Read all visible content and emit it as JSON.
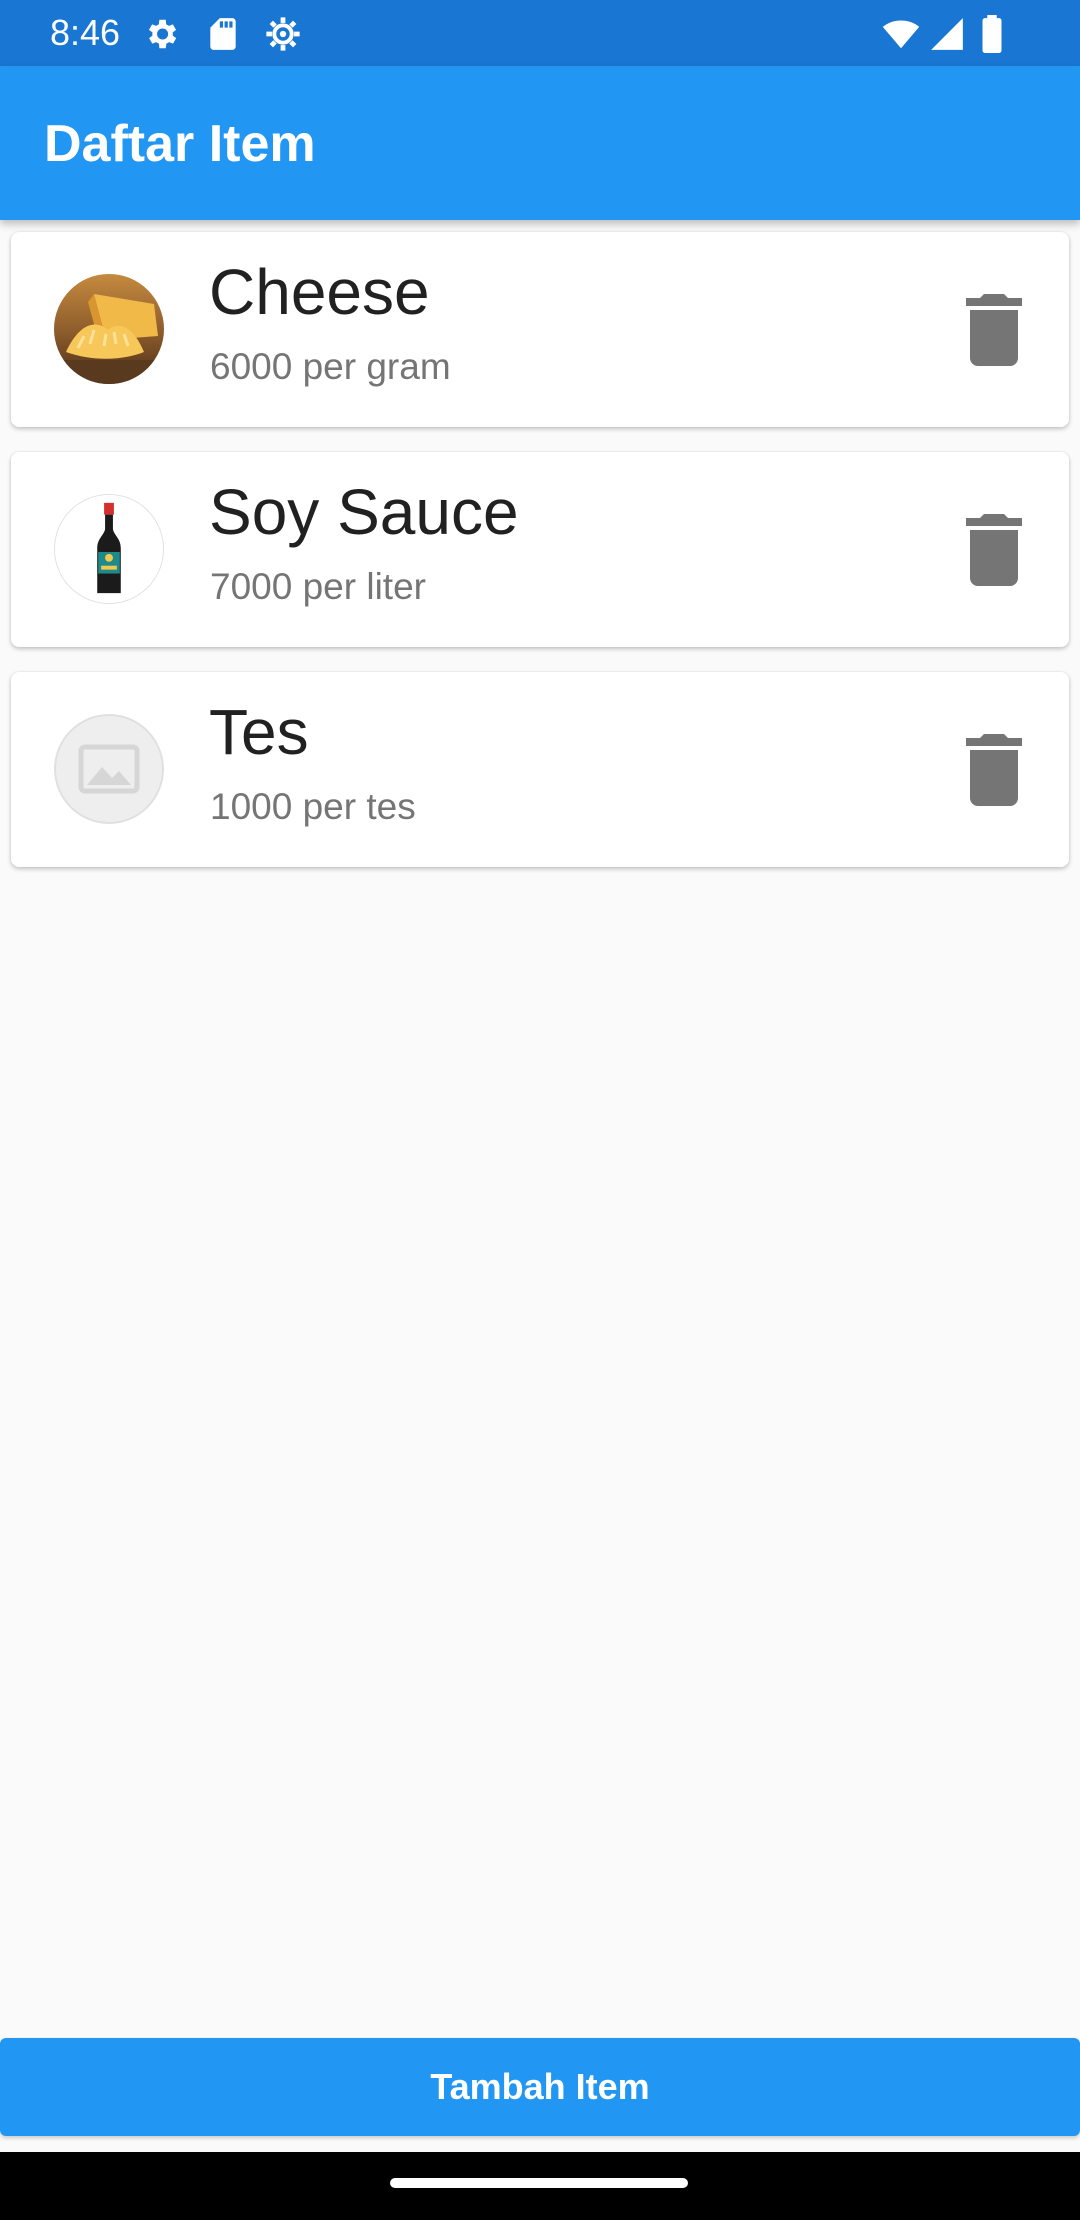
{
  "status_bar": {
    "time": "8:46",
    "icons": [
      "settings-icon",
      "sd-card-icon",
      "settings-alt-icon",
      "wifi-icon",
      "cellular-signal-icon",
      "battery-icon"
    ]
  },
  "app_bar": {
    "title": "Daftar Item",
    "color": "#2196f3"
  },
  "items": [
    {
      "name": "Cheese",
      "price": "6000 per gram",
      "image": "cheese-photo"
    },
    {
      "name": "Soy Sauce",
      "price": "7000 per liter",
      "image": "soy-sauce-bottle-photo"
    },
    {
      "name": "Tes",
      "price": "1000 per tes",
      "image": "image-placeholder-icon"
    }
  ],
  "actions": {
    "add_label": "Tambah Item",
    "delete_icon": "trash-icon"
  },
  "colors": {
    "primary": "#2196f3",
    "status_bar": "#1976d2",
    "background": "#fafafa",
    "delete_icon": "#757575"
  }
}
